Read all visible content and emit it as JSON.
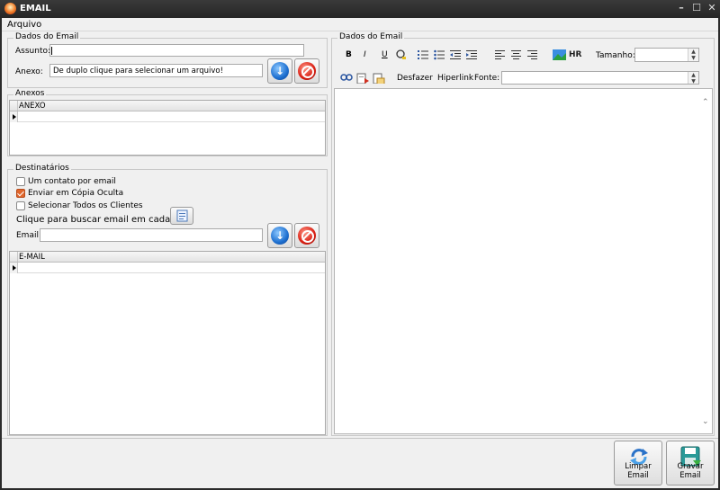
{
  "window": {
    "title": "EMAIL"
  },
  "menu": {
    "items": [
      "Arquivo"
    ]
  },
  "email_data": {
    "group_label": "Dados do Email",
    "assunto_label": "Assunto:",
    "assunto_value": "",
    "anexo_label": "Anexo:",
    "anexo_value": "De duplo clique para selecionar um arquivo!"
  },
  "anexos": {
    "group_label": "Anexos",
    "column": "ANEXO"
  },
  "destinatarios": {
    "group_label": "Destinatários",
    "checkboxes": [
      {
        "label": "Um contato por email",
        "checked": false
      },
      {
        "label": "Enviar em Cópia Oculta",
        "checked": true
      },
      {
        "label": "Selecionar Todos os Clientes",
        "checked": false
      }
    ],
    "search_label": "Clique para buscar email em cadastro:",
    "email_label": "Email:",
    "email_value": "",
    "column": "E-MAIL"
  },
  "editor": {
    "group_label": "Dados do Email",
    "bold": "B",
    "italic": "I",
    "underline": "U",
    "hr": "HR",
    "tamanho_label": "Tamanho:",
    "tamanho_value": "",
    "desfazer": "Desfazer",
    "hiperlink": "Hiperlink",
    "fonte_label": "Fonte:",
    "fonte_value": ""
  },
  "footer": {
    "limpar": "Limpar Email",
    "gravar": "Gravar Email"
  },
  "colors": {
    "check_accent": "#e0662c",
    "title_bg": "#2b2b2b"
  }
}
